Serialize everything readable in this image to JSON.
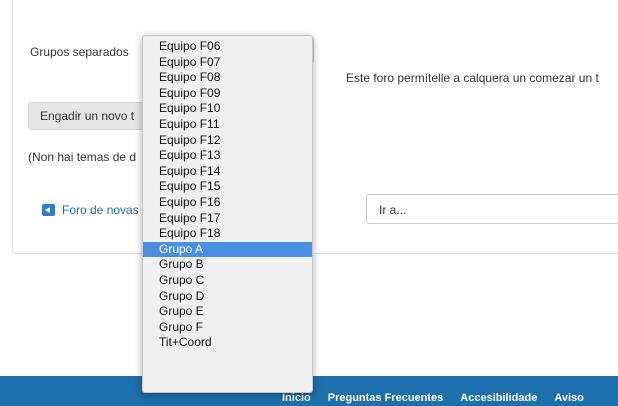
{
  "page": {
    "group_label": "Grupos separados",
    "intro_text": "Este foro permítelle a calquera un comezar un t",
    "add_topic_button": "Engadir un novo t",
    "no_topics_text": "(Non hai temas de d",
    "news_link": "Foro de novas",
    "jump_select_placeholder": "Ir a..."
  },
  "dropdown": {
    "options": [
      "Equipo F06",
      "Equipo F07",
      "Equipo F08",
      "Equipo F09",
      "Equipo F10",
      "Equipo F11",
      "Equipo F12",
      "Equipo F13",
      "Equipo F14",
      "Equipo F15",
      "Equipo F16",
      "Equipo F17",
      "Equipo F18",
      "Grupo A",
      "Grupo B",
      "Grupo C",
      "Grupo D",
      "Grupo E",
      "Grupo F",
      "Tit+Coord"
    ],
    "selected": "Grupo A"
  },
  "footer": {
    "links": [
      "Inicio",
      "Preguntas Frecuentes",
      "Accesibilidade",
      "Aviso"
    ]
  },
  "colors": {
    "accent": "#1e6fad",
    "selection": "#4a90e2",
    "link": "#1b6fb5"
  }
}
